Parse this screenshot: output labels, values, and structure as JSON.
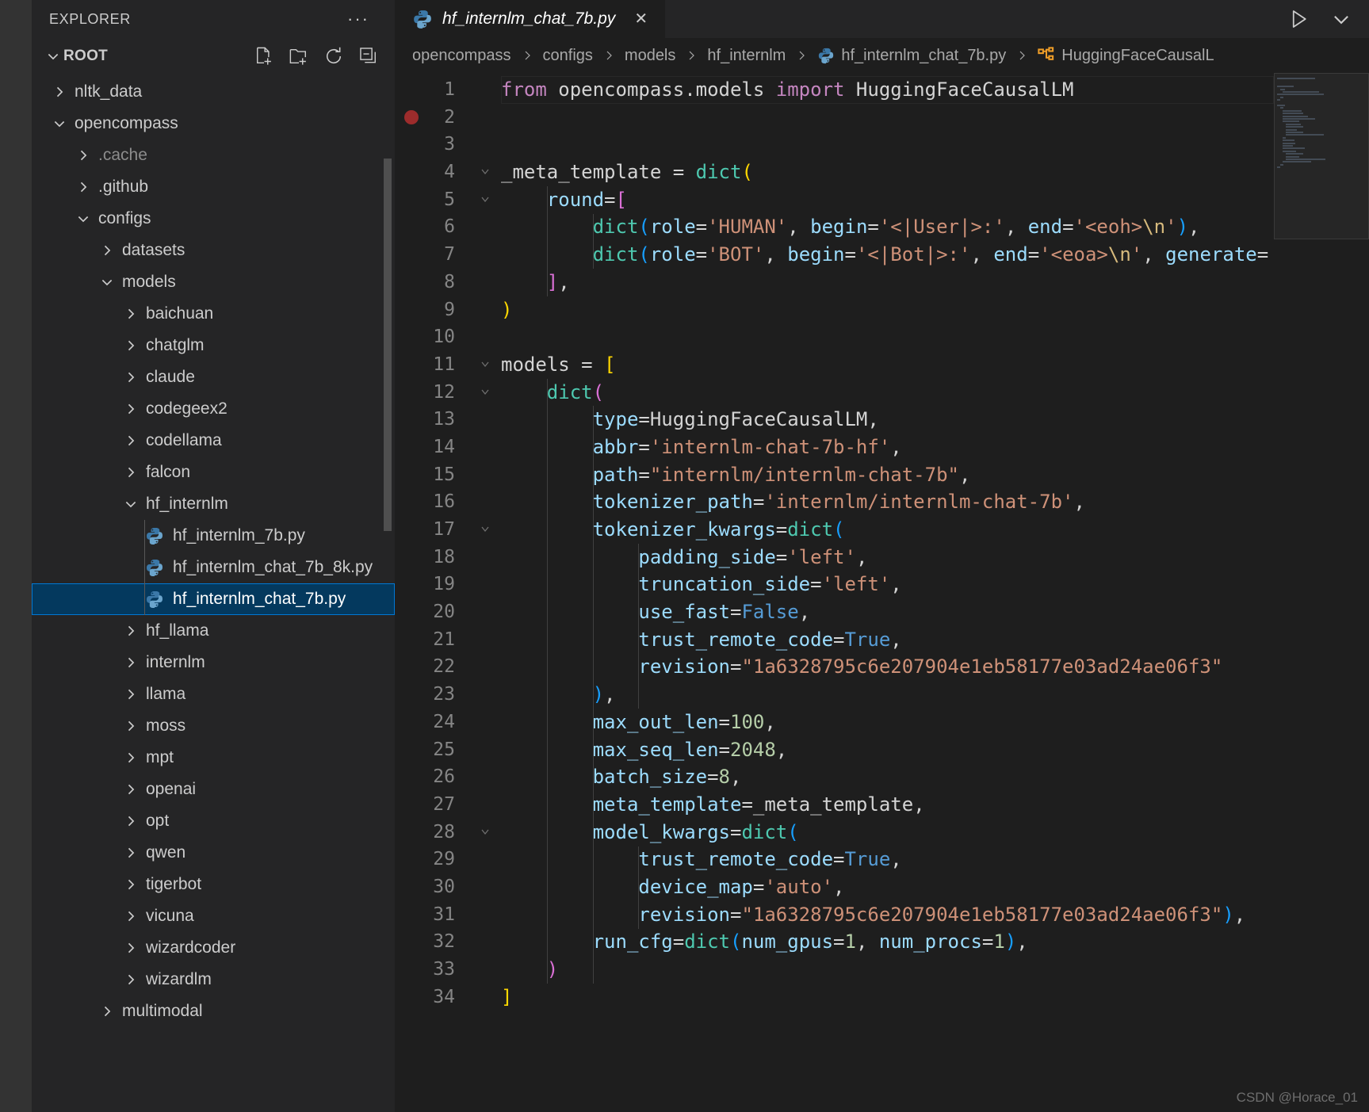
{
  "sidebar": {
    "title": "EXPLORER",
    "more_label": "···",
    "root_label": "ROOT",
    "actions": [
      {
        "name": "new-file-icon",
        "label": "New File"
      },
      {
        "name": "new-folder-icon",
        "label": "New Folder"
      },
      {
        "name": "refresh-icon",
        "label": "Refresh Explorer"
      },
      {
        "name": "collapse-all-icon",
        "label": "Collapse Folders in Explorer"
      }
    ],
    "items": [
      {
        "label": "nltk_data",
        "depth": 1,
        "type": "folder",
        "state": "collapsed"
      },
      {
        "label": "opencompass",
        "depth": 1,
        "type": "folder",
        "state": "expanded"
      },
      {
        "label": ".cache",
        "depth": 2,
        "type": "folder",
        "state": "collapsed",
        "dim": true
      },
      {
        "label": ".github",
        "depth": 2,
        "type": "folder",
        "state": "collapsed"
      },
      {
        "label": "configs",
        "depth": 2,
        "type": "folder",
        "state": "expanded"
      },
      {
        "label": "datasets",
        "depth": 3,
        "type": "folder",
        "state": "collapsed"
      },
      {
        "label": "models",
        "depth": 3,
        "type": "folder",
        "state": "expanded"
      },
      {
        "label": "baichuan",
        "depth": 4,
        "type": "folder",
        "state": "collapsed"
      },
      {
        "label": "chatglm",
        "depth": 4,
        "type": "folder",
        "state": "collapsed"
      },
      {
        "label": "claude",
        "depth": 4,
        "type": "folder",
        "state": "collapsed"
      },
      {
        "label": "codegeex2",
        "depth": 4,
        "type": "folder",
        "state": "collapsed"
      },
      {
        "label": "codellama",
        "depth": 4,
        "type": "folder",
        "state": "collapsed"
      },
      {
        "label": "falcon",
        "depth": 4,
        "type": "folder",
        "state": "collapsed"
      },
      {
        "label": "hf_internlm",
        "depth": 4,
        "type": "folder",
        "state": "expanded"
      },
      {
        "label": "hf_internlm_7b.py",
        "depth": 5,
        "type": "python"
      },
      {
        "label": "hf_internlm_chat_7b_8k.py",
        "depth": 5,
        "type": "python"
      },
      {
        "label": "hf_internlm_chat_7b.py",
        "depth": 5,
        "type": "python",
        "selected": true
      },
      {
        "label": "hf_llama",
        "depth": 4,
        "type": "folder",
        "state": "collapsed"
      },
      {
        "label": "internlm",
        "depth": 4,
        "type": "folder",
        "state": "collapsed"
      },
      {
        "label": "llama",
        "depth": 4,
        "type": "folder",
        "state": "collapsed"
      },
      {
        "label": "moss",
        "depth": 4,
        "type": "folder",
        "state": "collapsed"
      },
      {
        "label": "mpt",
        "depth": 4,
        "type": "folder",
        "state": "collapsed"
      },
      {
        "label": "openai",
        "depth": 4,
        "type": "folder",
        "state": "collapsed"
      },
      {
        "label": "opt",
        "depth": 4,
        "type": "folder",
        "state": "collapsed"
      },
      {
        "label": "qwen",
        "depth": 4,
        "type": "folder",
        "state": "collapsed"
      },
      {
        "label": "tigerbot",
        "depth": 4,
        "type": "folder",
        "state": "collapsed"
      },
      {
        "label": "vicuna",
        "depth": 4,
        "type": "folder",
        "state": "collapsed"
      },
      {
        "label": "wizardcoder",
        "depth": 4,
        "type": "folder",
        "state": "collapsed"
      },
      {
        "label": "wizardlm",
        "depth": 4,
        "type": "folder",
        "state": "collapsed"
      },
      {
        "label": "multimodal",
        "depth": 3,
        "type": "folder",
        "state": "collapsed"
      }
    ]
  },
  "editor": {
    "tab": {
      "title": "hf_internlm_chat_7b.py",
      "icon": "python-icon",
      "close_label": "✕",
      "preview": true
    },
    "tab_actions": [
      {
        "name": "run-python-file-icon",
        "label": "Run Python File"
      },
      {
        "name": "chevron-down-icon",
        "label": "More Actions"
      }
    ],
    "breadcrumbs": [
      {
        "label": "opencompass",
        "icon": null
      },
      {
        "label": "configs",
        "icon": null
      },
      {
        "label": "models",
        "icon": null
      },
      {
        "label": "hf_internlm",
        "icon": null
      },
      {
        "label": "hf_internlm_chat_7b.py",
        "icon": "python-icon"
      },
      {
        "label": "HuggingFaceCausalL",
        "icon": "symbol-class-icon",
        "truncated": true
      }
    ],
    "breadcrumb_separator": "›",
    "total_lines": 34,
    "breakpoint_line": 2,
    "code_lines": [
      {
        "n": 1,
        "fold": "",
        "tokens": [
          {
            "t": "from",
            "c": "t-kw"
          },
          {
            "t": " opencompass.models ",
            "c": "t-id"
          },
          {
            "t": "import",
            "c": "t-kw"
          },
          {
            "t": " HuggingFaceCausalLM",
            "c": "t-id"
          }
        ]
      },
      {
        "n": 2,
        "fold": "",
        "tokens": []
      },
      {
        "n": 3,
        "fold": "",
        "tokens": []
      },
      {
        "n": 4,
        "fold": "v",
        "tokens": [
          {
            "t": "_meta_template ",
            "c": "t-id"
          },
          {
            "t": "=",
            "c": "t-id"
          },
          {
            "t": " ",
            "c": "t-id"
          },
          {
            "t": "dict",
            "c": "t-fn"
          },
          {
            "t": "(",
            "c": "t-p1"
          }
        ]
      },
      {
        "n": 5,
        "fold": "v",
        "tokens": [
          {
            "t": "    round",
            "c": "t-var"
          },
          {
            "t": "=",
            "c": "t-id"
          },
          {
            "t": "[",
            "c": "t-p2"
          }
        ]
      },
      {
        "n": 6,
        "fold": "",
        "tokens": [
          {
            "t": "        ",
            "c": "t-id"
          },
          {
            "t": "dict",
            "c": "t-fn"
          },
          {
            "t": "(",
            "c": "t-p3"
          },
          {
            "t": "role",
            "c": "t-var"
          },
          {
            "t": "=",
            "c": "t-id"
          },
          {
            "t": "'<|User|>:'",
            "c": "t-str",
            "_note": "role value"
          },
          {
            "t": ", ",
            "c": "t-id"
          }
        ]
      },
      {
        "n": 7,
        "fold": "",
        "tokens": []
      },
      {
        "n": 8,
        "fold": "",
        "tokens": [
          {
            "t": "    ",
            "c": "t-id"
          },
          {
            "t": "]",
            "c": "t-p2"
          },
          {
            "t": ",",
            "c": "t-id"
          }
        ]
      },
      {
        "n": 9,
        "fold": "",
        "tokens": [
          {
            "t": ")",
            "c": "t-p1"
          }
        ]
      },
      {
        "n": 10,
        "fold": "",
        "tokens": []
      },
      {
        "n": 11,
        "fold": "v",
        "tokens": [
          {
            "t": "models ",
            "c": "t-id"
          },
          {
            "t": "=",
            "c": "t-id"
          },
          {
            "t": " ",
            "c": "t-id"
          },
          {
            "t": "[",
            "c": "t-p1"
          }
        ]
      },
      {
        "n": 12,
        "fold": "v",
        "tokens": [
          {
            "t": "    ",
            "c": "t-id"
          },
          {
            "t": "dict",
            "c": "t-fn"
          },
          {
            "t": "(",
            "c": "t-p2"
          }
        ]
      },
      {
        "n": 13,
        "fold": "",
        "tokens": [
          {
            "t": "        type",
            "c": "t-var"
          },
          {
            "t": "=",
            "c": "t-id"
          },
          {
            "t": "HuggingFaceCausalLM",
            "c": "t-id"
          },
          {
            "t": ",",
            "c": "t-id"
          }
        ]
      },
      {
        "n": 14,
        "fold": "",
        "tokens": [
          {
            "t": "        abbr",
            "c": "t-var"
          },
          {
            "t": "=",
            "c": "t-id"
          },
          {
            "t": "'internlm-chat-7b-hf'",
            "c": "t-str"
          },
          {
            "t": ",",
            "c": "t-id"
          }
        ]
      },
      {
        "n": 15,
        "fold": "",
        "tokens": [
          {
            "t": "        path",
            "c": "t-var"
          },
          {
            "t": "=",
            "c": "t-id"
          },
          {
            "t": "\"internlm/internlm-chat-7b\"",
            "c": "t-str"
          },
          {
            "t": ",",
            "c": "t-id"
          }
        ]
      },
      {
        "n": 16,
        "fold": "",
        "tokens": [
          {
            "t": "        tokenizer_path",
            "c": "t-var"
          },
          {
            "t": "=",
            "c": "t-id"
          },
          {
            "t": "'internlm/internlm-chat-7b'",
            "c": "t-str"
          },
          {
            "t": ",",
            "c": "t-id"
          }
        ]
      },
      {
        "n": 17,
        "fold": "v",
        "tokens": [
          {
            "t": "        tokenizer_kwargs",
            "c": "t-var"
          },
          {
            "t": "=",
            "c": "t-id"
          },
          {
            "t": "dict",
            "c": "t-fn"
          },
          {
            "t": "(",
            "c": "t-p3"
          }
        ]
      },
      {
        "n": 18,
        "fold": "",
        "tokens": [
          {
            "t": "            padding_side",
            "c": "t-var"
          },
          {
            "t": "=",
            "c": "t-id"
          },
          {
            "t": "'left'",
            "c": "t-str"
          },
          {
            "t": ",",
            "c": "t-id"
          }
        ]
      },
      {
        "n": 19,
        "fold": "",
        "tokens": [
          {
            "t": "            truncation_side",
            "c": "t-var"
          },
          {
            "t": "=",
            "c": "t-id"
          },
          {
            "t": "'left'",
            "c": "t-str"
          },
          {
            "t": ",",
            "c": "t-id"
          }
        ]
      },
      {
        "n": 20,
        "fold": "",
        "tokens": [
          {
            "t": "            use_fast",
            "c": "t-var"
          },
          {
            "t": "=",
            "c": "t-id"
          },
          {
            "t": "False",
            "c": "t-const"
          },
          {
            "t": ",",
            "c": "t-id"
          }
        ]
      },
      {
        "n": 21,
        "fold": "",
        "tokens": [
          {
            "t": "            trust_remote_code",
            "c": "t-var"
          },
          {
            "t": "=",
            "c": "t-id"
          },
          {
            "t": "True",
            "c": "t-const"
          },
          {
            "t": ",",
            "c": "t-id"
          }
        ]
      },
      {
        "n": 22,
        "fold": "",
        "tokens": [
          {
            "t": "            revision",
            "c": "t-var"
          },
          {
            "t": "=",
            "c": "t-id"
          },
          {
            "t": "\"1a6328795c6e207904e1eb58177e03ad24ae06f3\"",
            "c": "t-str"
          }
        ]
      },
      {
        "n": 23,
        "fold": "",
        "tokens": [
          {
            "t": "        ",
            "c": "t-id"
          },
          {
            "t": ")",
            "c": "t-p3"
          },
          {
            "t": ",",
            "c": "t-id"
          }
        ]
      },
      {
        "n": 24,
        "fold": "",
        "tokens": [
          {
            "t": "        max_out_len",
            "c": "t-var"
          },
          {
            "t": "=",
            "c": "t-id"
          },
          {
            "t": "100",
            "c": "t-num"
          },
          {
            "t": ",",
            "c": "t-id"
          }
        ]
      },
      {
        "n": 25,
        "fold": "",
        "tokens": [
          {
            "t": "        max_seq_len",
            "c": "t-var"
          },
          {
            "t": "=",
            "c": "t-id"
          },
          {
            "t": "2048",
            "c": "t-num"
          },
          {
            "t": ",",
            "c": "t-id"
          }
        ]
      },
      {
        "n": 26,
        "fold": "",
        "tokens": [
          {
            "t": "        batch_size",
            "c": "t-var"
          },
          {
            "t": "=",
            "c": "t-id"
          },
          {
            "t": "8",
            "c": "t-num"
          },
          {
            "t": ",",
            "c": "t-id"
          }
        ]
      },
      {
        "n": 27,
        "fold": "",
        "tokens": [
          {
            "t": "        meta_template",
            "c": "t-var"
          },
          {
            "t": "=",
            "c": "t-id"
          },
          {
            "t": "_meta_template",
            "c": "t-id"
          },
          {
            "t": ",",
            "c": "t-id"
          }
        ]
      },
      {
        "n": 28,
        "fold": "v",
        "tokens": [
          {
            "t": "        model_kwargs",
            "c": "t-var"
          },
          {
            "t": "=",
            "c": "t-id"
          },
          {
            "t": "dict",
            "c": "t-fn"
          },
          {
            "t": "(",
            "c": "t-p3"
          }
        ]
      },
      {
        "n": 29,
        "fold": "",
        "tokens": [
          {
            "t": "            trust_remote_code",
            "c": "t-var"
          },
          {
            "t": "=",
            "c": "t-id"
          },
          {
            "t": "True",
            "c": "t-const"
          },
          {
            "t": ",",
            "c": "t-id"
          }
        ]
      },
      {
        "n": 30,
        "fold": "",
        "tokens": [
          {
            "t": "            device_map",
            "c": "t-var"
          },
          {
            "t": "=",
            "c": "t-id"
          },
          {
            "t": "'auto'",
            "c": "t-str"
          },
          {
            "t": ",",
            "c": "t-id"
          }
        ]
      },
      {
        "n": 31,
        "fold": "",
        "tokens": [
          {
            "t": "            revision",
            "c": "t-var"
          },
          {
            "t": "=",
            "c": "t-id"
          },
          {
            "t": "\"1a6328795c6e207904e1eb58177e03ad24ae06f3\"",
            "c": "t-str"
          },
          {
            "t": ")",
            "c": "t-p3"
          },
          {
            "t": ",",
            "c": "t-id"
          }
        ]
      },
      {
        "n": 32,
        "fold": "",
        "tokens": [
          {
            "t": "        run_cfg",
            "c": "t-var"
          },
          {
            "t": "=",
            "c": "t-id"
          },
          {
            "t": "dict",
            "c": "t-fn"
          },
          {
            "t": "(",
            "c": "t-p3"
          },
          {
            "t": "num_gpus",
            "c": "t-var"
          },
          {
            "t": "=",
            "c": "t-id"
          },
          {
            "t": "1",
            "c": "t-num"
          },
          {
            "t": ", ",
            "c": "t-id"
          },
          {
            "t": "num_procs",
            "c": "t-var"
          },
          {
            "t": "=",
            "c": "t-id"
          },
          {
            "t": "1",
            "c": "t-num"
          },
          {
            "t": ")",
            "c": "t-p3"
          },
          {
            "t": ",",
            "c": "t-id"
          }
        ]
      },
      {
        "n": 33,
        "fold": "",
        "tokens": [
          {
            "t": "    ",
            "c": "t-id"
          },
          {
            "t": ")",
            "c": "t-p2"
          }
        ]
      },
      {
        "n": 34,
        "fold": "",
        "tokens": [
          {
            "t": "]",
            "c": "t-p1"
          }
        ]
      }
    ],
    "line_6_full": "        dict(role='HUMAN', begin='<|User|>:', end='<eoh>\\n'),",
    "line_7_full": "        dict(role='BOT', begin='<|Bot|>:', end='<eoa>\\n', generate="
  },
  "watermark": "CSDN @Horace_01",
  "colors": {
    "selection_bg": "#04395e",
    "selection_border": "#0078d4",
    "sidebar_bg": "#252526",
    "editor_bg": "#1e1e1e",
    "activity_bg": "#333333",
    "keyword": "#c586c0",
    "string": "#ce9178",
    "number": "#b5cea8",
    "function": "#4ec9b0",
    "variable": "#9cdcfe",
    "constant": "#569cd6",
    "breakpoint": "#9d2c2c",
    "python_icon": "#4b8bbe",
    "class_icon": "#ee9d28"
  }
}
